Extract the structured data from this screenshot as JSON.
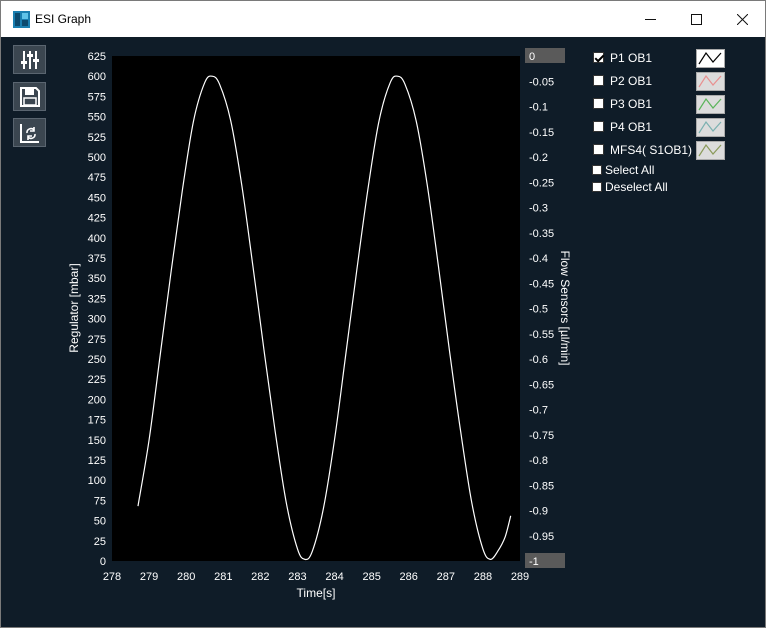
{
  "window": {
    "title": "ESI Graph"
  },
  "toolbar": {
    "buttons": [
      {
        "name": "settings-sliders-icon"
      },
      {
        "name": "save-icon"
      },
      {
        "name": "refresh-chart-icon"
      }
    ]
  },
  "legend": {
    "items": [
      {
        "label": "P1 OB1",
        "checked": true,
        "swatch_bg": "#ffffff",
        "line_color": "#000000"
      },
      {
        "label": "P2 OB1",
        "checked": false,
        "swatch_bg": "#dcdcdc",
        "line_color": "#e89090"
      },
      {
        "label": "P3 OB1",
        "checked": false,
        "swatch_bg": "#dcdcdc",
        "line_color": "#5ab45a"
      },
      {
        "label": "P4 OB1",
        "checked": false,
        "swatch_bg": "#dcdcdc",
        "line_color": "#7ab0b0"
      },
      {
        "label": "MFS4( S1OB1)",
        "checked": false,
        "swatch_bg": "#dcdcdc",
        "line_color": "#8a9a5a"
      }
    ],
    "select_all": "Select All",
    "deselect_all": "Deselect All"
  },
  "chart_data": {
    "type": "line",
    "xlabel": "Time[s]",
    "ylabel": "Regulator [mbar]",
    "y2label": "Flow Sensors [µl/min]",
    "xlim": [
      278,
      289
    ],
    "ylim": [
      0,
      625
    ],
    "y2lim": [
      -1,
      0
    ],
    "x_ticks": [
      "278",
      "279",
      "280",
      "281",
      "282",
      "283",
      "284",
      "285",
      "286",
      "287",
      "288",
      "289"
    ],
    "y_ticks": [
      "0",
      "25",
      "50",
      "75",
      "100",
      "125",
      "150",
      "175",
      "200",
      "225",
      "250",
      "275",
      "300",
      "325",
      "350",
      "375",
      "400",
      "425",
      "450",
      "475",
      "500",
      "525",
      "550",
      "575",
      "600",
      "625"
    ],
    "y2_ticks": [
      "0",
      "-0.05",
      "-0.1",
      "-0.15",
      "-0.2",
      "-0.25",
      "-0.3",
      "-0.35",
      "-0.4",
      "-0.45",
      "-0.5",
      "-0.55",
      "-0.6",
      "-0.65",
      "-0.7",
      "-0.75",
      "-0.8",
      "-0.85",
      "-0.9",
      "-0.95",
      "-1"
    ],
    "background": "#000000",
    "series": [
      {
        "name": "P1 OB1",
        "color": "#ffffff",
        "x": [
          278.7,
          279.0,
          279.3,
          279.6,
          279.9,
          280.2,
          280.5,
          280.7,
          280.9,
          281.2,
          281.5,
          281.8,
          282.1,
          282.4,
          282.7,
          283.0,
          283.2,
          283.4,
          283.7,
          284.0,
          284.3,
          284.6,
          284.9,
          285.2,
          285.5,
          285.7,
          285.9,
          286.2,
          286.5,
          286.8,
          287.1,
          287.4,
          287.7,
          288.0,
          288.2,
          288.4,
          288.6,
          288.75
        ],
        "y": [
          68,
          150,
          255,
          360,
          460,
          545,
          592,
          600,
          590,
          545,
          465,
          365,
          260,
          160,
          72,
          15,
          2,
          12,
          65,
          150,
          255,
          360,
          460,
          545,
          592,
          600,
          590,
          545,
          465,
          365,
          260,
          160,
          72,
          15,
          2,
          12,
          30,
          56
        ]
      }
    ]
  }
}
